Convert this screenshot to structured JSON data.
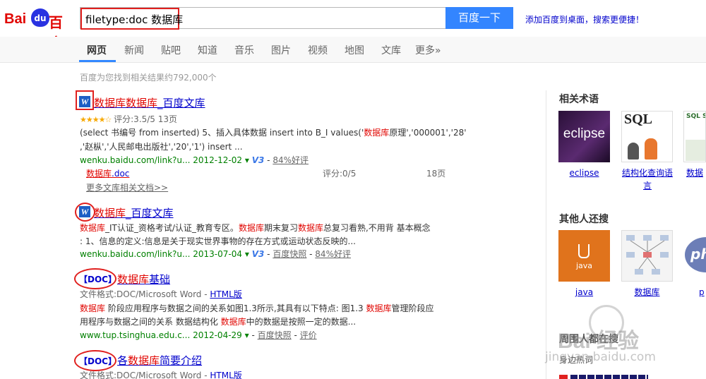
{
  "header": {
    "logo_text_left": "Bai",
    "logo_text_mid": "du",
    "logo_text_right": "百度",
    "search_query": "filetype:doc 数据库",
    "search_button": "百度一下",
    "add_to_desktop": "添加百度到桌面，搜索更便捷！"
  },
  "nav": {
    "items": [
      "网页",
      "新闻",
      "贴吧",
      "知道",
      "音乐",
      "图片",
      "视频",
      "地图",
      "文库",
      "更多»"
    ],
    "active": "网页"
  },
  "result_count": "百度为您找到相关结果约792,000个",
  "results": [
    {
      "title_a": "数据库数据库",
      "title_b": "_百度文库",
      "rating": "评分:3.5/5 13页",
      "snippet1_a": "(select 书编号 from inserted) 5、插入具体数据 insert into B_I values('",
      "snippet1_em": "数据库",
      "snippet1_b": "原理','000001','28'",
      "snippet2": ",'赵枞','人民邮电出版社','20','1') insert ...",
      "url": "wenku.baidu.com/link?u... 2012-12-02",
      "v3": "V3",
      "good": "84%好评",
      "sub_title_em": "数据库",
      "sub_title_rest": ".doc",
      "sub_score": "评分:0/5",
      "sub_pages": "18页",
      "more_docs": "更多文库相关文档>>"
    },
    {
      "title_a": "数据库",
      "title_b": "_百度文库",
      "snippet1_em1": "数据库",
      "snippet1_a": "_IT认证_资格考试/认证_教育专区。",
      "snippet1_em2": "数据库",
      "snippet1_b": "期末复习",
      "snippet1_em3": "数据库",
      "snippet1_c": "总复习看熟,不用背 基本概念",
      "snippet2": ": 1、信息的定义:信息是关于现实世界事物的存在方式或运动状态反映的...",
      "url": "wenku.baidu.com/link?u... 2013-07-04",
      "v3": "V3",
      "snapshot": "百度快照",
      "good": "84%好评"
    },
    {
      "tag": "【DOC】",
      "title_a": "数据库",
      "title_b": "基础",
      "format_label": "文件格式:DOC/Microsoft Word - ",
      "format_link": "HTML版",
      "snippet1_em1": "数据库",
      "snippet1_a": " 阶段应用程序与数据之间的关系如图1.3所示,其具有以下特点: 图1.3 ",
      "snippet1_em2": "数据库",
      "snippet1_b": "管理阶段应",
      "snippet2_a": "用程序与数据之间的关系 数据结构化 ",
      "snippet2_em": "数据库",
      "snippet2_b": "中的数据是按照一定的数据...",
      "url": "www.tup.tsinghua.edu.c... 2012-04-29",
      "snapshot": "百度快照",
      "review": "评价"
    },
    {
      "tag": "【DOC】",
      "title_a": "各",
      "title_em": "数据库",
      "title_b": "简要介绍",
      "format_label": "文件格式:DOC/Microsoft Word - ",
      "format_link": "HTML版"
    }
  ],
  "sidebar": {
    "related_heading": "相关术语",
    "related": [
      {
        "caption": "eclipse",
        "thumb_text": "eclipse"
      },
      {
        "caption": "结构化查询语言",
        "thumb_text": "SQL"
      },
      {
        "caption": "数据",
        "thumb_text": "SQL Se"
      }
    ],
    "others_heading": "其他人还搜",
    "others": [
      {
        "caption": "java",
        "thumb_text": "java"
      },
      {
        "caption": "数据库",
        "thumb_text": ""
      },
      {
        "caption": "p",
        "thumb_text": "ph"
      }
    ],
    "bottom_heading": "周围人都在搜",
    "bottom_sub": "身边热词"
  },
  "watermark": {
    "text": "Bai 经验",
    "url": "jingyan.baidu.com"
  },
  "colors": {
    "link": "#0000cc",
    "highlight": "#e10602",
    "url": "#008000",
    "button": "#3385ff",
    "annotation": "#e0201e"
  }
}
